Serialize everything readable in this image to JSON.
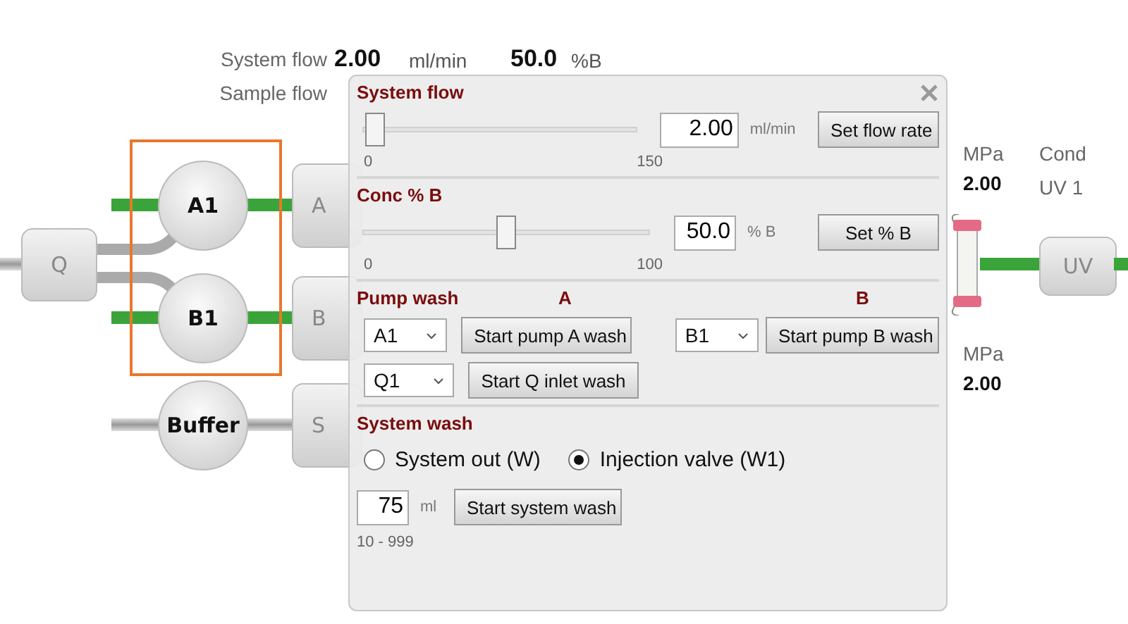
{
  "header": {
    "system_flow": {
      "label": "System flow",
      "value": "2.00",
      "unit": "ml/min"
    },
    "conc_b": {
      "value": "50.0",
      "unit": "%B"
    },
    "sample_flow": {
      "label": "Sample flow"
    }
  },
  "diagram": {
    "inlet": "Q",
    "pumps": [
      {
        "label": "A1",
        "flowing": true,
        "highlighted": true
      },
      {
        "label": "B1",
        "flowing": true,
        "highlighted": true
      },
      {
        "label": "Buffer",
        "flowing": false,
        "highlighted": false
      }
    ],
    "valves": [
      "A",
      "B",
      "S"
    ],
    "pressures": [
      {
        "unit": "MPa",
        "value": "2.00"
      },
      {
        "unit": "MPa",
        "value": "2.00"
      }
    ],
    "monitors": [
      "Cond",
      "UV 1"
    ],
    "detector": "UV"
  },
  "dialog": {
    "system_flow": {
      "title": "System flow",
      "level": 0.013,
      "min": "0",
      "max": "150",
      "value": "2.00",
      "unit": "ml/min",
      "button": "Set flow rate"
    },
    "conc_b": {
      "title": "Conc % B",
      "level": 0.5,
      "min": "0",
      "max": "100",
      "value": "50.0",
      "unit": "% B",
      "button": "Set % B"
    },
    "pump_wash": {
      "title": "Pump wash",
      "column_a": "A",
      "column_b": "B",
      "rows": [
        {
          "select": "A1",
          "button": "Start pump A wash"
        },
        {
          "select": "B1",
          "button": "Start pump B wash"
        },
        {
          "select": "Q1",
          "button": "Start Q inlet wash"
        }
      ]
    },
    "system_wash": {
      "title": "System wash",
      "options": [
        {
          "label": "System out (W)",
          "selected": false
        },
        {
          "label": "Injection valve (W1)",
          "selected": true
        }
      ],
      "volume": "75",
      "unit": "ml",
      "button": "Start system wash",
      "range": "10 - 999"
    }
  }
}
